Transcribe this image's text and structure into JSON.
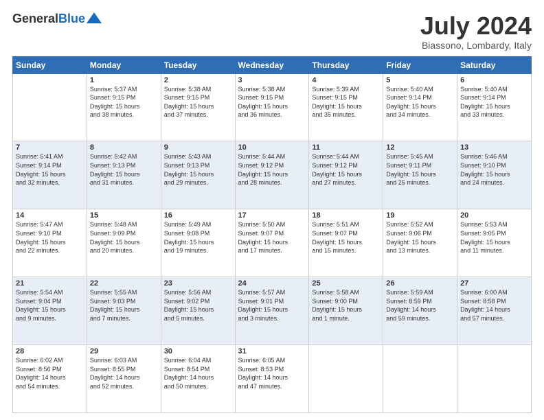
{
  "header": {
    "logo_general": "General",
    "logo_blue": "Blue",
    "month_title": "July 2024",
    "location": "Biassono, Lombardy, Italy"
  },
  "weekdays": [
    "Sunday",
    "Monday",
    "Tuesday",
    "Wednesday",
    "Thursday",
    "Friday",
    "Saturday"
  ],
  "weeks": [
    [
      {
        "day": "",
        "info": ""
      },
      {
        "day": "1",
        "info": "Sunrise: 5:37 AM\nSunset: 9:15 PM\nDaylight: 15 hours\nand 38 minutes."
      },
      {
        "day": "2",
        "info": "Sunrise: 5:38 AM\nSunset: 9:15 PM\nDaylight: 15 hours\nand 37 minutes."
      },
      {
        "day": "3",
        "info": "Sunrise: 5:38 AM\nSunset: 9:15 PM\nDaylight: 15 hours\nand 36 minutes."
      },
      {
        "day": "4",
        "info": "Sunrise: 5:39 AM\nSunset: 9:15 PM\nDaylight: 15 hours\nand 35 minutes."
      },
      {
        "day": "5",
        "info": "Sunrise: 5:40 AM\nSunset: 9:14 PM\nDaylight: 15 hours\nand 34 minutes."
      },
      {
        "day": "6",
        "info": "Sunrise: 5:40 AM\nSunset: 9:14 PM\nDaylight: 15 hours\nand 33 minutes."
      }
    ],
    [
      {
        "day": "7",
        "info": "Sunrise: 5:41 AM\nSunset: 9:14 PM\nDaylight: 15 hours\nand 32 minutes."
      },
      {
        "day": "8",
        "info": "Sunrise: 5:42 AM\nSunset: 9:13 PM\nDaylight: 15 hours\nand 31 minutes."
      },
      {
        "day": "9",
        "info": "Sunrise: 5:43 AM\nSunset: 9:13 PM\nDaylight: 15 hours\nand 29 minutes."
      },
      {
        "day": "10",
        "info": "Sunrise: 5:44 AM\nSunset: 9:12 PM\nDaylight: 15 hours\nand 28 minutes."
      },
      {
        "day": "11",
        "info": "Sunrise: 5:44 AM\nSunset: 9:12 PM\nDaylight: 15 hours\nand 27 minutes."
      },
      {
        "day": "12",
        "info": "Sunrise: 5:45 AM\nSunset: 9:11 PM\nDaylight: 15 hours\nand 25 minutes."
      },
      {
        "day": "13",
        "info": "Sunrise: 5:46 AM\nSunset: 9:10 PM\nDaylight: 15 hours\nand 24 minutes."
      }
    ],
    [
      {
        "day": "14",
        "info": "Sunrise: 5:47 AM\nSunset: 9:10 PM\nDaylight: 15 hours\nand 22 minutes."
      },
      {
        "day": "15",
        "info": "Sunrise: 5:48 AM\nSunset: 9:09 PM\nDaylight: 15 hours\nand 20 minutes."
      },
      {
        "day": "16",
        "info": "Sunrise: 5:49 AM\nSunset: 9:08 PM\nDaylight: 15 hours\nand 19 minutes."
      },
      {
        "day": "17",
        "info": "Sunrise: 5:50 AM\nSunset: 9:07 PM\nDaylight: 15 hours\nand 17 minutes."
      },
      {
        "day": "18",
        "info": "Sunrise: 5:51 AM\nSunset: 9:07 PM\nDaylight: 15 hours\nand 15 minutes."
      },
      {
        "day": "19",
        "info": "Sunrise: 5:52 AM\nSunset: 9:06 PM\nDaylight: 15 hours\nand 13 minutes."
      },
      {
        "day": "20",
        "info": "Sunrise: 5:53 AM\nSunset: 9:05 PM\nDaylight: 15 hours\nand 11 minutes."
      }
    ],
    [
      {
        "day": "21",
        "info": "Sunrise: 5:54 AM\nSunset: 9:04 PM\nDaylight: 15 hours\nand 9 minutes."
      },
      {
        "day": "22",
        "info": "Sunrise: 5:55 AM\nSunset: 9:03 PM\nDaylight: 15 hours\nand 7 minutes."
      },
      {
        "day": "23",
        "info": "Sunrise: 5:56 AM\nSunset: 9:02 PM\nDaylight: 15 hours\nand 5 minutes."
      },
      {
        "day": "24",
        "info": "Sunrise: 5:57 AM\nSunset: 9:01 PM\nDaylight: 15 hours\nand 3 minutes."
      },
      {
        "day": "25",
        "info": "Sunrise: 5:58 AM\nSunset: 9:00 PM\nDaylight: 15 hours\nand 1 minute."
      },
      {
        "day": "26",
        "info": "Sunrise: 5:59 AM\nSunset: 8:59 PM\nDaylight: 14 hours\nand 59 minutes."
      },
      {
        "day": "27",
        "info": "Sunrise: 6:00 AM\nSunset: 8:58 PM\nDaylight: 14 hours\nand 57 minutes."
      }
    ],
    [
      {
        "day": "28",
        "info": "Sunrise: 6:02 AM\nSunset: 8:56 PM\nDaylight: 14 hours\nand 54 minutes."
      },
      {
        "day": "29",
        "info": "Sunrise: 6:03 AM\nSunset: 8:55 PM\nDaylight: 14 hours\nand 52 minutes."
      },
      {
        "day": "30",
        "info": "Sunrise: 6:04 AM\nSunset: 8:54 PM\nDaylight: 14 hours\nand 50 minutes."
      },
      {
        "day": "31",
        "info": "Sunrise: 6:05 AM\nSunset: 8:53 PM\nDaylight: 14 hours\nand 47 minutes."
      },
      {
        "day": "",
        "info": ""
      },
      {
        "day": "",
        "info": ""
      },
      {
        "day": "",
        "info": ""
      }
    ]
  ]
}
